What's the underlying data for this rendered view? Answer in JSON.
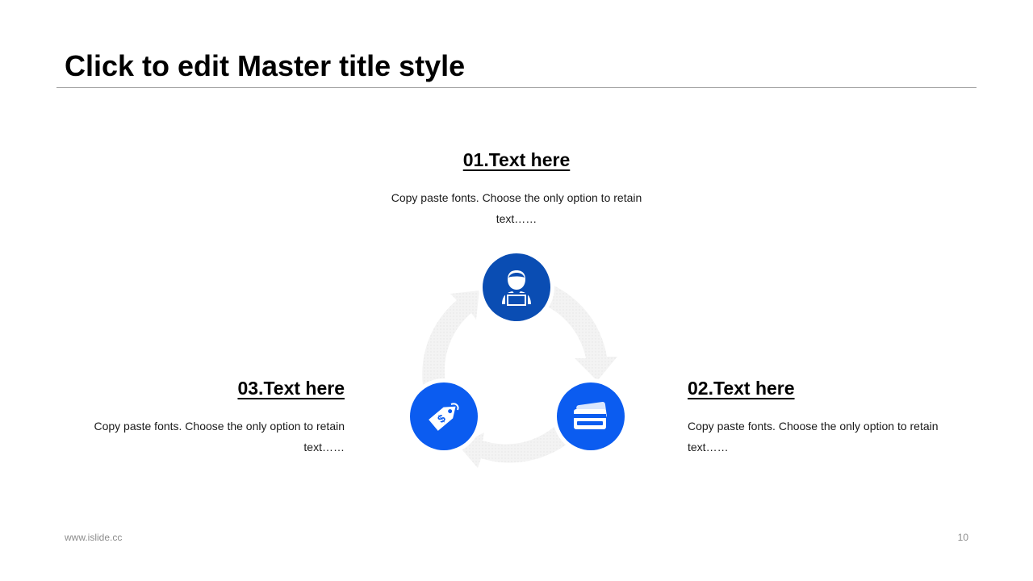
{
  "slide": {
    "title": "Click to edit Master title style",
    "page_number": "10"
  },
  "footer": {
    "website": "www.islide.cc"
  },
  "colors": {
    "primary_dark": "#0a4db3",
    "primary_bright": "#0b5cf0",
    "arrow": "#f0f0f0",
    "rule": "#a6a6a6"
  },
  "items": [
    {
      "heading": "01.Text here",
      "text": "Copy paste fonts. Choose the only option to retain text……",
      "icon": "person-laptop-icon"
    },
    {
      "heading": "02.Text here",
      "text": "Copy paste fonts. Choose the only option to retain text……",
      "icon": "credit-card-icon"
    },
    {
      "heading": "03.Text here",
      "text": "Copy paste fonts. Choose the only option to retain text……",
      "icon": "price-tag-icon"
    }
  ]
}
